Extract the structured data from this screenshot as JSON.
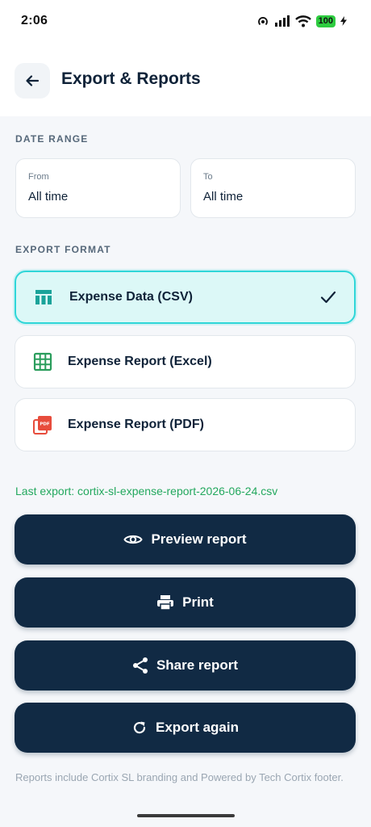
{
  "status_bar": {
    "time": "2:06",
    "battery": "100"
  },
  "header": {
    "title": "Export & Reports",
    "back_icon": "arrow-left-icon"
  },
  "date_range": {
    "section_label": "DATE RANGE",
    "from": {
      "label": "From",
      "value": "All time"
    },
    "to": {
      "label": "To",
      "value": "All time"
    }
  },
  "export_format": {
    "section_label": "EXPORT FORMAT",
    "options": [
      {
        "label": "Expense Data (CSV)",
        "icon": "table-icon",
        "selected": true
      },
      {
        "label": "Expense Report (Excel)",
        "icon": "spreadsheet-icon",
        "selected": false
      },
      {
        "label": "Expense Report (PDF)",
        "icon": "pdf-icon",
        "selected": false
      }
    ]
  },
  "last_export": "Last export: cortix-sl-expense-report-2026-06-24.csv",
  "actions": {
    "preview": "Preview report",
    "print": "Print",
    "share": "Share report",
    "export_again": "Export again"
  },
  "footer_note": "Reports include Cortix SL branding and Powered by Tech Cortix footer.",
  "colors": {
    "primary": "#112a44",
    "accent": "#2fd6d8",
    "success": "#23a85e"
  }
}
